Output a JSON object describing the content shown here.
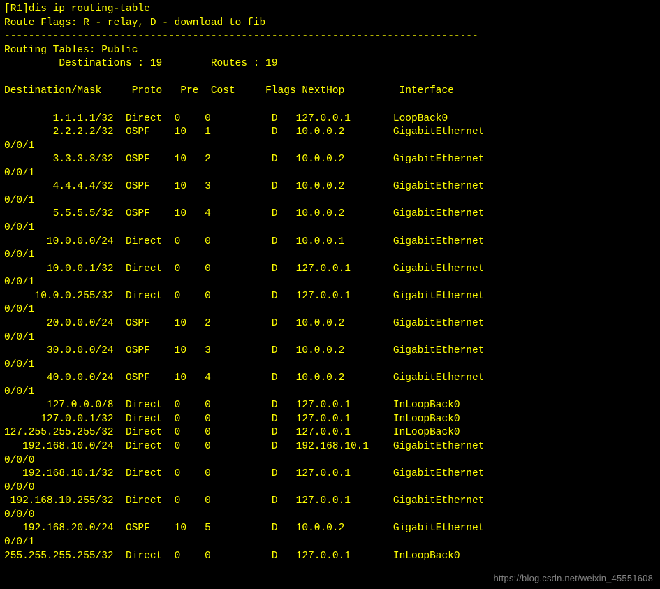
{
  "prompt": "[R1]dis ip routing-table",
  "flags_line": "Route Flags: R - relay, D - download to fib",
  "separator": "------------------------------------------------------------------------------",
  "table_name": "Routing Tables: Public",
  "dest_label": "Destinations : ",
  "dest_count": "19",
  "routes_label": "Routes : ",
  "routes_count": "19",
  "headers": {
    "dest": "Destination/Mask",
    "proto": "Proto",
    "pre": "Pre",
    "cost": "Cost",
    "flags": "Flags",
    "nexthop": "NextHop",
    "iface": "Interface"
  },
  "routes": [
    {
      "dest": "1.1.1.1/32",
      "proto": "Direct",
      "pre": "0",
      "cost": "0",
      "flags": "D",
      "nexthop": "127.0.0.1",
      "iface": "LoopBack0",
      "wrap": ""
    },
    {
      "dest": "2.2.2.2/32",
      "proto": "OSPF",
      "pre": "10",
      "cost": "1",
      "flags": "D",
      "nexthop": "10.0.0.2",
      "iface": "GigabitEthernet",
      "wrap": "0/0/1"
    },
    {
      "dest": "3.3.3.3/32",
      "proto": "OSPF",
      "pre": "10",
      "cost": "2",
      "flags": "D",
      "nexthop": "10.0.0.2",
      "iface": "GigabitEthernet",
      "wrap": "0/0/1"
    },
    {
      "dest": "4.4.4.4/32",
      "proto": "OSPF",
      "pre": "10",
      "cost": "3",
      "flags": "D",
      "nexthop": "10.0.0.2",
      "iface": "GigabitEthernet",
      "wrap": "0/0/1"
    },
    {
      "dest": "5.5.5.5/32",
      "proto": "OSPF",
      "pre": "10",
      "cost": "4",
      "flags": "D",
      "nexthop": "10.0.0.2",
      "iface": "GigabitEthernet",
      "wrap": "0/0/1"
    },
    {
      "dest": "10.0.0.0/24",
      "proto": "Direct",
      "pre": "0",
      "cost": "0",
      "flags": "D",
      "nexthop": "10.0.0.1",
      "iface": "GigabitEthernet",
      "wrap": "0/0/1"
    },
    {
      "dest": "10.0.0.1/32",
      "proto": "Direct",
      "pre": "0",
      "cost": "0",
      "flags": "D",
      "nexthop": "127.0.0.1",
      "iface": "GigabitEthernet",
      "wrap": "0/0/1"
    },
    {
      "dest": "10.0.0.255/32",
      "proto": "Direct",
      "pre": "0",
      "cost": "0",
      "flags": "D",
      "nexthop": "127.0.0.1",
      "iface": "GigabitEthernet",
      "wrap": "0/0/1"
    },
    {
      "dest": "20.0.0.0/24",
      "proto": "OSPF",
      "pre": "10",
      "cost": "2",
      "flags": "D",
      "nexthop": "10.0.0.2",
      "iface": "GigabitEthernet",
      "wrap": "0/0/1"
    },
    {
      "dest": "30.0.0.0/24",
      "proto": "OSPF",
      "pre": "10",
      "cost": "3",
      "flags": "D",
      "nexthop": "10.0.0.2",
      "iface": "GigabitEthernet",
      "wrap": "0/0/1"
    },
    {
      "dest": "40.0.0.0/24",
      "proto": "OSPF",
      "pre": "10",
      "cost": "4",
      "flags": "D",
      "nexthop": "10.0.0.2",
      "iface": "GigabitEthernet",
      "wrap": "0/0/1"
    },
    {
      "dest": "127.0.0.0/8",
      "proto": "Direct",
      "pre": "0",
      "cost": "0",
      "flags": "D",
      "nexthop": "127.0.0.1",
      "iface": "InLoopBack0",
      "wrap": ""
    },
    {
      "dest": "127.0.0.1/32",
      "proto": "Direct",
      "pre": "0",
      "cost": "0",
      "flags": "D",
      "nexthop": "127.0.0.1",
      "iface": "InLoopBack0",
      "wrap": ""
    },
    {
      "dest": "127.255.255.255/32",
      "proto": "Direct",
      "pre": "0",
      "cost": "0",
      "flags": "D",
      "nexthop": "127.0.0.1",
      "iface": "InLoopBack0",
      "wrap": ""
    },
    {
      "dest": "192.168.10.0/24",
      "proto": "Direct",
      "pre": "0",
      "cost": "0",
      "flags": "D",
      "nexthop": "192.168.10.1",
      "iface": "GigabitEthernet",
      "wrap": "0/0/0"
    },
    {
      "dest": "192.168.10.1/32",
      "proto": "Direct",
      "pre": "0",
      "cost": "0",
      "flags": "D",
      "nexthop": "127.0.0.1",
      "iface": "GigabitEthernet",
      "wrap": "0/0/0"
    },
    {
      "dest": "192.168.10.255/32",
      "proto": "Direct",
      "pre": "0",
      "cost": "0",
      "flags": "D",
      "nexthop": "127.0.0.1",
      "iface": "GigabitEthernet",
      "wrap": "0/0/0"
    },
    {
      "dest": "192.168.20.0/24",
      "proto": "OSPF",
      "pre": "10",
      "cost": "5",
      "flags": "D",
      "nexthop": "10.0.0.2",
      "iface": "GigabitEthernet",
      "wrap": "0/0/1"
    },
    {
      "dest": "255.255.255.255/32",
      "proto": "Direct",
      "pre": "0",
      "cost": "0",
      "flags": "D",
      "nexthop": "127.0.0.1",
      "iface": "InLoopBack0",
      "wrap": ""
    }
  ],
  "watermark": "https://blog.csdn.net/weixin_45551608"
}
